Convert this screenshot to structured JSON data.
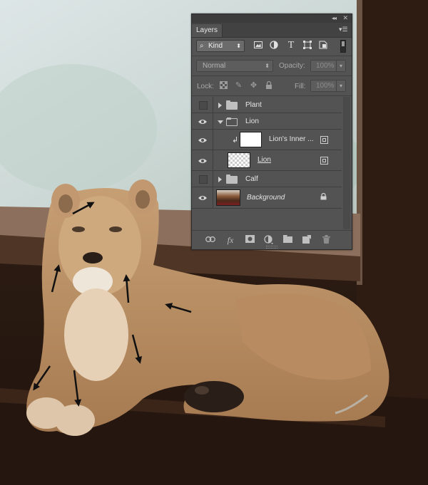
{
  "panel": {
    "tab_label": "Layers",
    "filter": {
      "kind_label": "Kind",
      "icons": [
        "image-filter-icon",
        "adjustment-filter-icon",
        "type-filter-icon",
        "shape-filter-icon",
        "smart-object-filter-icon"
      ]
    },
    "blend_mode": "Normal",
    "opacity_label": "Opacity:",
    "opacity_value": "100%",
    "lock_label": "Lock:",
    "fill_label": "Fill:",
    "fill_value": "100%"
  },
  "layers": [
    {
      "name": "Plant",
      "kind": "group",
      "visible": false,
      "expanded": false
    },
    {
      "name": "Lion",
      "kind": "group",
      "visible": true,
      "expanded": true
    },
    {
      "name": "Lion's Inner ...",
      "kind": "smart-object",
      "clipped": true,
      "visible": true
    },
    {
      "name": "Lion",
      "kind": "smart-object",
      "visible": true
    },
    {
      "name": "Calf",
      "kind": "group",
      "visible": false,
      "expanded": false
    },
    {
      "name": "Background",
      "kind": "background",
      "visible": true,
      "locked": true
    }
  ],
  "bottom_icons": [
    "link-icon",
    "fx-icon",
    "mask-icon",
    "adjustment-layer-icon",
    "new-group-icon",
    "new-layer-icon",
    "trash-icon"
  ],
  "colors": {
    "panel_bg": "#535353",
    "panel_border": "#2b2b2b",
    "text": "#e4e4e4"
  }
}
